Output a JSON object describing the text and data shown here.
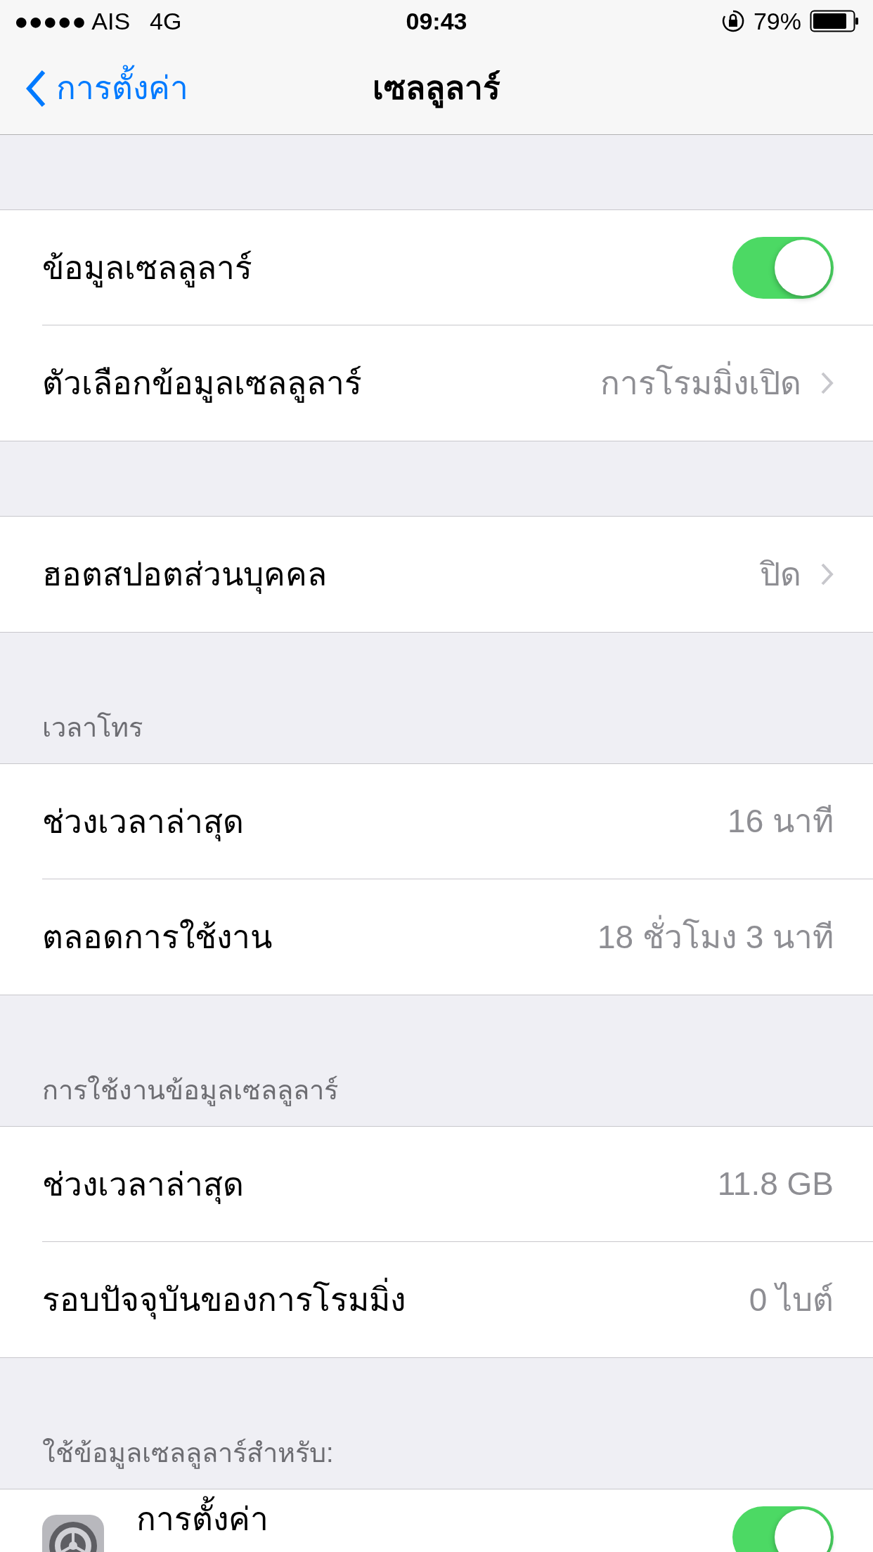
{
  "status_bar": {
    "carrier": "●●●●● AIS",
    "network": "4G",
    "time": "09:43",
    "battery": "79%"
  },
  "nav": {
    "back": "การตั้งค่า",
    "title": "เซลลูลาร์"
  },
  "sections": [
    {
      "rows": [
        {
          "kind": "toggle",
          "label": "ข้อมูลเซลลูลาร์",
          "on": true
        },
        {
          "kind": "value",
          "label": "ตัวเลือกข้อมูลเซลลูลาร์",
          "value": "การโรมมิ่งเปิด",
          "chevron": true
        }
      ]
    },
    {
      "rows": [
        {
          "kind": "value",
          "label": "ฮอตสปอตส่วนบุคคล",
          "value": "ปิด",
          "chevron": true
        }
      ]
    },
    {
      "header": "เวลาโทร",
      "rows": [
        {
          "kind": "value",
          "label": "ช่วงเวลาล่าสุด",
          "value": "16 นาที",
          "chevron": false
        },
        {
          "kind": "value",
          "label": "ตลอดการใช้งาน",
          "value": "18 ชั่วโมง 3 นาที",
          "chevron": false
        }
      ]
    },
    {
      "header": "การใช้งานข้อมูลเซลลูลาร์",
      "rows": [
        {
          "kind": "value",
          "label": "ช่วงเวลาล่าสุด",
          "value": "11.8 GB",
          "chevron": false
        },
        {
          "kind": "value",
          "label": "รอบปัจจุบันของการโรมมิ่ง",
          "value": "0 ไบต์",
          "chevron": false
        }
      ]
    },
    {
      "header": "ใช้ข้อมูลเซลลูลาร์สำหรับ:",
      "rows": [
        {
          "kind": "app_toggle",
          "label": "การตั้งค่า",
          "on": true
        }
      ]
    }
  ]
}
